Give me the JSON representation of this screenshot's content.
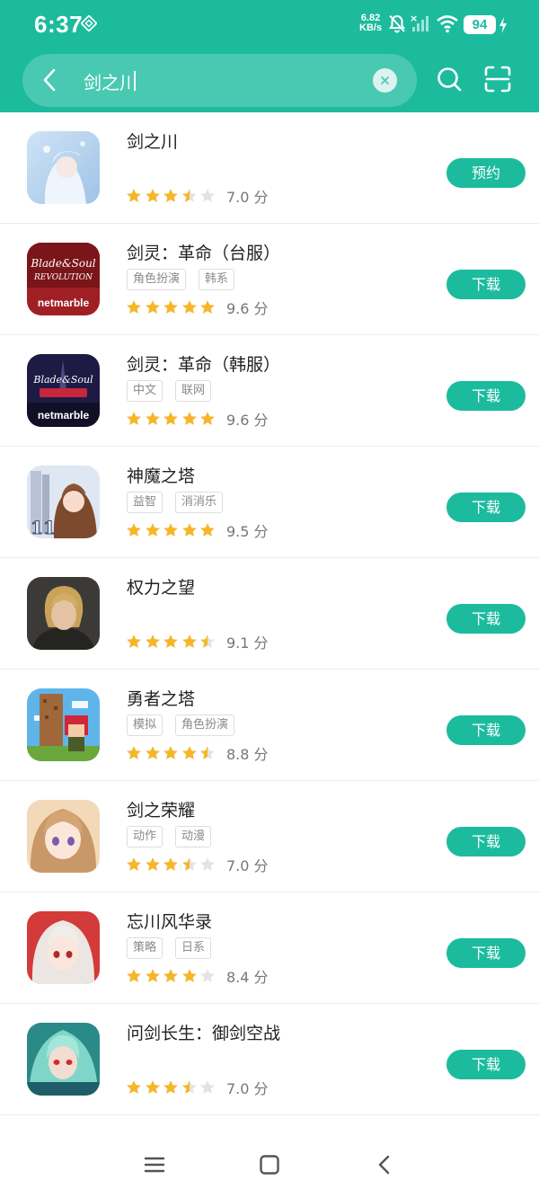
{
  "status_bar": {
    "time": "6:37",
    "net_speed_value": "6.82",
    "net_speed_unit": "KB/s",
    "battery": "94"
  },
  "search": {
    "query": "剑之川"
  },
  "colors": {
    "accent": "#1cbb9e",
    "star_filled": "#f6b627",
    "star_empty": "#e3e3e3"
  },
  "apps": [
    {
      "name": "剑之川",
      "tags": [],
      "rating": 3.5,
      "score": "7.0 分",
      "action": "预约",
      "icon": "snow-princess-icon"
    },
    {
      "name": "剑灵：革命（台服）",
      "tags": [
        "角色扮演",
        "韩系"
      ],
      "rating": 5,
      "score": "9.6 分",
      "action": "下载",
      "icon": "blade-and-soul-tw-icon"
    },
    {
      "name": "剑灵：革命（韩服）",
      "tags": [
        "中文",
        "联网"
      ],
      "rating": 5,
      "score": "9.6 分",
      "action": "下载",
      "icon": "blade-and-soul-kr-icon"
    },
    {
      "name": "神魔之塔",
      "tags": [
        "益智",
        "消消乐"
      ],
      "rating": 5,
      "score": "9.5 分",
      "action": "下载",
      "icon": "tower-of-saviors-icon"
    },
    {
      "name": "权力之望",
      "tags": [],
      "rating": 4.5,
      "score": "9.1 分",
      "action": "下载",
      "icon": "warrior-portrait-icon"
    },
    {
      "name": "勇者之塔",
      "tags": [
        "模拟",
        "角色扮演"
      ],
      "rating": 4.5,
      "score": "8.8 分",
      "action": "下载",
      "icon": "pixel-tower-icon"
    },
    {
      "name": "剑之荣耀",
      "tags": [
        "动作",
        "动漫"
      ],
      "rating": 3.5,
      "score": "7.0 分",
      "action": "下载",
      "icon": "anime-girl-icon"
    },
    {
      "name": "忘川风华录",
      "tags": [
        "策略",
        "日系"
      ],
      "rating": 4,
      "score": "8.4 分",
      "action": "下载",
      "icon": "silver-hair-girl-icon"
    },
    {
      "name": "问剑长生：御剑空战",
      "tags": [],
      "rating": 3.5,
      "score": "7.0 分",
      "action": "下载",
      "icon": "green-hair-warrior-icon"
    }
  ]
}
